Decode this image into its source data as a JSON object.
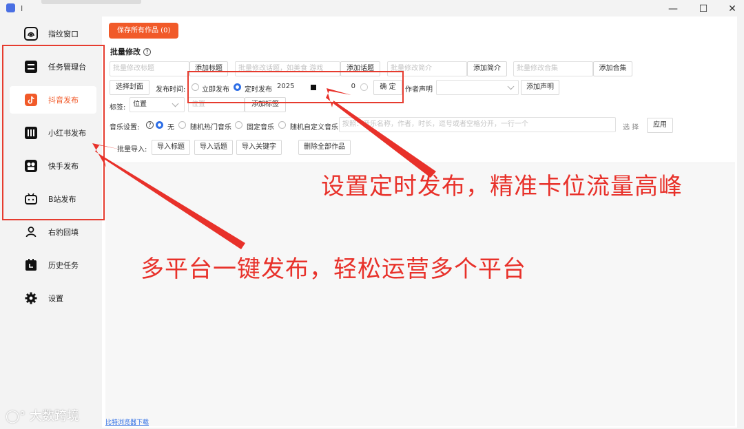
{
  "window": {
    "title": "I"
  },
  "sidebar": {
    "items": [
      {
        "label": "指纹窗口",
        "icon": "fingerprint-icon"
      },
      {
        "label": "任务管理台",
        "icon": "task-list-icon"
      },
      {
        "label": "抖音发布",
        "icon": "douyin-icon",
        "active": true
      },
      {
        "label": "小红书发布",
        "icon": "xiaohongshu-icon"
      },
      {
        "label": "快手发布",
        "icon": "kuaishou-icon"
      },
      {
        "label": "B站发布",
        "icon": "bilibili-icon"
      },
      {
        "label": "右豹回填",
        "icon": "user-icon"
      },
      {
        "label": "历史任务",
        "icon": "history-icon"
      },
      {
        "label": "设置",
        "icon": "gear-icon"
      }
    ]
  },
  "toolbar": {
    "save_all": "保存所有作品 (0)"
  },
  "batch": {
    "title": "批量修改",
    "title_placeholder": "批量修改标题",
    "add_title": "添加标题",
    "topic_placeholder": "批量修改话题，如美食 游戏",
    "add_topic": "添加话题",
    "intro_placeholder": "批量修改简介",
    "add_intro": "添加简介",
    "collection_placeholder": "批量修改合集",
    "add_collection": "添加合集",
    "select_cover": "选择封面",
    "publish_time_label": "发布时间:",
    "publish_now": "立即发布",
    "publish_scheduled": "定时发布",
    "date_value": "2025",
    "time_value": "0",
    "confirm": "确 定",
    "author_label": "作者声明",
    "add_statement": "添加声明",
    "tag_label": "标签:",
    "tag_select": "位置",
    "location_placeholder": "位置",
    "add_tag": "添加标签",
    "music_label": "音乐设置:",
    "music_none": "无",
    "music_hot": "随机热门音乐",
    "music_fixed": "固定音乐",
    "music_custom": "随机自定义音乐",
    "music_placeholder": "按照：音乐名称，作者，时长，逗号或者空格分开，一行一个",
    "choose": "选 择",
    "apply": "应用",
    "import_label": "批量导入:",
    "import_title": "导入标题",
    "import_topic": "导入话题",
    "import_keyword": "导入关键字",
    "delete_all": "删除全部作品"
  },
  "annotations": {
    "top": "设置定时发布，精准卡位流量高峰",
    "left": "多平台一键发布，轻松运营多个平台"
  },
  "footer": {
    "link": "比特浏览器下载"
  },
  "watermark": "大数跨境",
  "colors": {
    "accent": "#f15a29",
    "annotation": "#e8312a",
    "radio": "#2f6fe6"
  }
}
